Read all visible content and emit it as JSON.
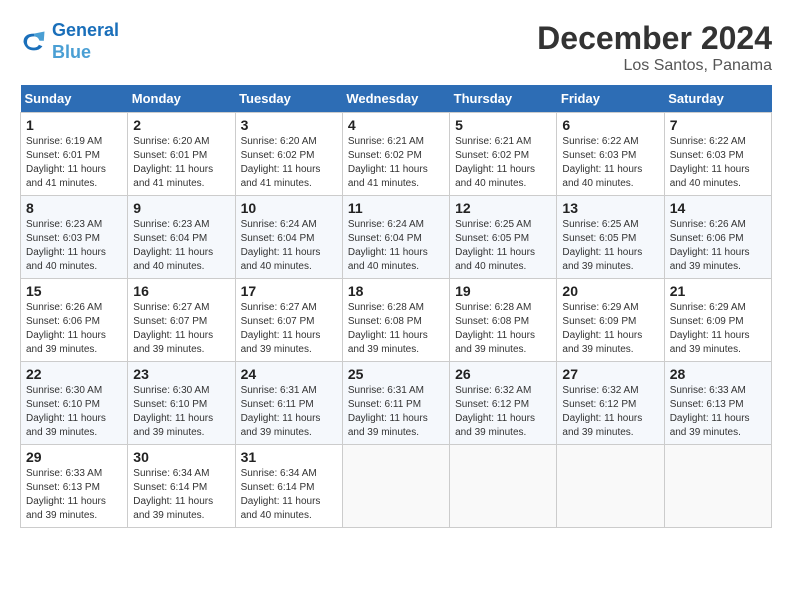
{
  "header": {
    "logo_line1": "General",
    "logo_line2": "Blue",
    "month": "December 2024",
    "location": "Los Santos, Panama"
  },
  "weekdays": [
    "Sunday",
    "Monday",
    "Tuesday",
    "Wednesday",
    "Thursday",
    "Friday",
    "Saturday"
  ],
  "weeks": [
    [
      {
        "day": "1",
        "sunrise": "6:19 AM",
        "sunset": "6:01 PM",
        "daylight": "11 hours and 41 minutes."
      },
      {
        "day": "2",
        "sunrise": "6:20 AM",
        "sunset": "6:01 PM",
        "daylight": "11 hours and 41 minutes."
      },
      {
        "day": "3",
        "sunrise": "6:20 AM",
        "sunset": "6:02 PM",
        "daylight": "11 hours and 41 minutes."
      },
      {
        "day": "4",
        "sunrise": "6:21 AM",
        "sunset": "6:02 PM",
        "daylight": "11 hours and 41 minutes."
      },
      {
        "day": "5",
        "sunrise": "6:21 AM",
        "sunset": "6:02 PM",
        "daylight": "11 hours and 40 minutes."
      },
      {
        "day": "6",
        "sunrise": "6:22 AM",
        "sunset": "6:03 PM",
        "daylight": "11 hours and 40 minutes."
      },
      {
        "day": "7",
        "sunrise": "6:22 AM",
        "sunset": "6:03 PM",
        "daylight": "11 hours and 40 minutes."
      }
    ],
    [
      {
        "day": "8",
        "sunrise": "6:23 AM",
        "sunset": "6:03 PM",
        "daylight": "11 hours and 40 minutes."
      },
      {
        "day": "9",
        "sunrise": "6:23 AM",
        "sunset": "6:04 PM",
        "daylight": "11 hours and 40 minutes."
      },
      {
        "day": "10",
        "sunrise": "6:24 AM",
        "sunset": "6:04 PM",
        "daylight": "11 hours and 40 minutes."
      },
      {
        "day": "11",
        "sunrise": "6:24 AM",
        "sunset": "6:04 PM",
        "daylight": "11 hours and 40 minutes."
      },
      {
        "day": "12",
        "sunrise": "6:25 AM",
        "sunset": "6:05 PM",
        "daylight": "11 hours and 40 minutes."
      },
      {
        "day": "13",
        "sunrise": "6:25 AM",
        "sunset": "6:05 PM",
        "daylight": "11 hours and 39 minutes."
      },
      {
        "day": "14",
        "sunrise": "6:26 AM",
        "sunset": "6:06 PM",
        "daylight": "11 hours and 39 minutes."
      }
    ],
    [
      {
        "day": "15",
        "sunrise": "6:26 AM",
        "sunset": "6:06 PM",
        "daylight": "11 hours and 39 minutes."
      },
      {
        "day": "16",
        "sunrise": "6:27 AM",
        "sunset": "6:07 PM",
        "daylight": "11 hours and 39 minutes."
      },
      {
        "day": "17",
        "sunrise": "6:27 AM",
        "sunset": "6:07 PM",
        "daylight": "11 hours and 39 minutes."
      },
      {
        "day": "18",
        "sunrise": "6:28 AM",
        "sunset": "6:08 PM",
        "daylight": "11 hours and 39 minutes."
      },
      {
        "day": "19",
        "sunrise": "6:28 AM",
        "sunset": "6:08 PM",
        "daylight": "11 hours and 39 minutes."
      },
      {
        "day": "20",
        "sunrise": "6:29 AM",
        "sunset": "6:09 PM",
        "daylight": "11 hours and 39 minutes."
      },
      {
        "day": "21",
        "sunrise": "6:29 AM",
        "sunset": "6:09 PM",
        "daylight": "11 hours and 39 minutes."
      }
    ],
    [
      {
        "day": "22",
        "sunrise": "6:30 AM",
        "sunset": "6:10 PM",
        "daylight": "11 hours and 39 minutes."
      },
      {
        "day": "23",
        "sunrise": "6:30 AM",
        "sunset": "6:10 PM",
        "daylight": "11 hours and 39 minutes."
      },
      {
        "day": "24",
        "sunrise": "6:31 AM",
        "sunset": "6:11 PM",
        "daylight": "11 hours and 39 minutes."
      },
      {
        "day": "25",
        "sunrise": "6:31 AM",
        "sunset": "6:11 PM",
        "daylight": "11 hours and 39 minutes."
      },
      {
        "day": "26",
        "sunrise": "6:32 AM",
        "sunset": "6:12 PM",
        "daylight": "11 hours and 39 minutes."
      },
      {
        "day": "27",
        "sunrise": "6:32 AM",
        "sunset": "6:12 PM",
        "daylight": "11 hours and 39 minutes."
      },
      {
        "day": "28",
        "sunrise": "6:33 AM",
        "sunset": "6:13 PM",
        "daylight": "11 hours and 39 minutes."
      }
    ],
    [
      {
        "day": "29",
        "sunrise": "6:33 AM",
        "sunset": "6:13 PM",
        "daylight": "11 hours and 39 minutes."
      },
      {
        "day": "30",
        "sunrise": "6:34 AM",
        "sunset": "6:14 PM",
        "daylight": "11 hours and 39 minutes."
      },
      {
        "day": "31",
        "sunrise": "6:34 AM",
        "sunset": "6:14 PM",
        "daylight": "11 hours and 40 minutes."
      },
      null,
      null,
      null,
      null
    ]
  ]
}
